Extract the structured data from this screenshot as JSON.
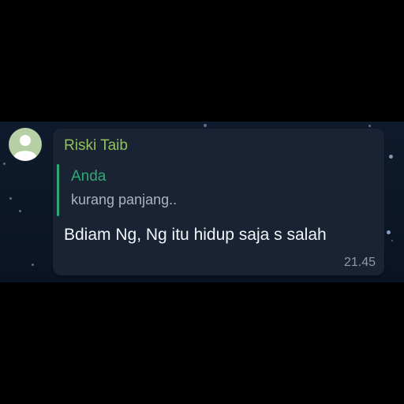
{
  "sender": {
    "name": "Riski Taib"
  },
  "reply": {
    "author": "Anda",
    "text": "kurang panjang.."
  },
  "message": {
    "text": "Bdiam Ng, Ng itu hidup saja s salah",
    "time": "21.45"
  },
  "colors": {
    "sender_name": "#8fc25a",
    "reply_accent": "#2fa876",
    "bubble_bg": "#1a2333",
    "avatar_bg": "#b6d0a6"
  },
  "icons": {
    "avatar": "user-placeholder-icon"
  }
}
